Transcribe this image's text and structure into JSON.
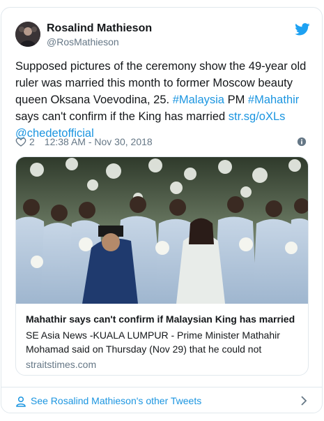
{
  "author": {
    "name": "Rosalind Mathieson",
    "handle": "@RosMathieson"
  },
  "tweet": {
    "segments": [
      {
        "text": "Supposed pictures of the ceremony show the 49-year old ruler was married this month to former Moscow beauty queen Oksana Voevodina, 25. ",
        "link": false
      },
      {
        "text": "#Malaysia",
        "link": true
      },
      {
        "text": " PM ",
        "link": false
      },
      {
        "text": "#Mahathir",
        "link": true
      },
      {
        "text": " says can't confirm if the King has married ",
        "link": false
      },
      {
        "text": "str.sg/oXLs",
        "link": true
      },
      {
        "text": " ",
        "link": false
      },
      {
        "text": "@chedetofficial",
        "link": true
      }
    ],
    "likes": "2",
    "timestamp": "12:38 AM - Nov 30, 2018"
  },
  "card": {
    "title": "Mahathir says can't confirm if Malaysian King has married",
    "description": "SE Asia News -KUALA LUMPUR - Prime Minister Mathahir Mohamad said on Thursday (Nov 29) that he could not",
    "domain": "straitstimes.com"
  },
  "footer": {
    "link_text": "See Rosalind Mathieson's other Tweets"
  },
  "colors": {
    "link": "#1b95e0",
    "secondary_text": "#657786",
    "border": "#e1e8ed",
    "twitter_blue": "#1da1f2"
  },
  "icons": {
    "brand": "twitter-bird-icon",
    "like": "heart-icon",
    "info": "info-icon",
    "profile": "user-icon",
    "chevron": "chevron-right-icon"
  }
}
